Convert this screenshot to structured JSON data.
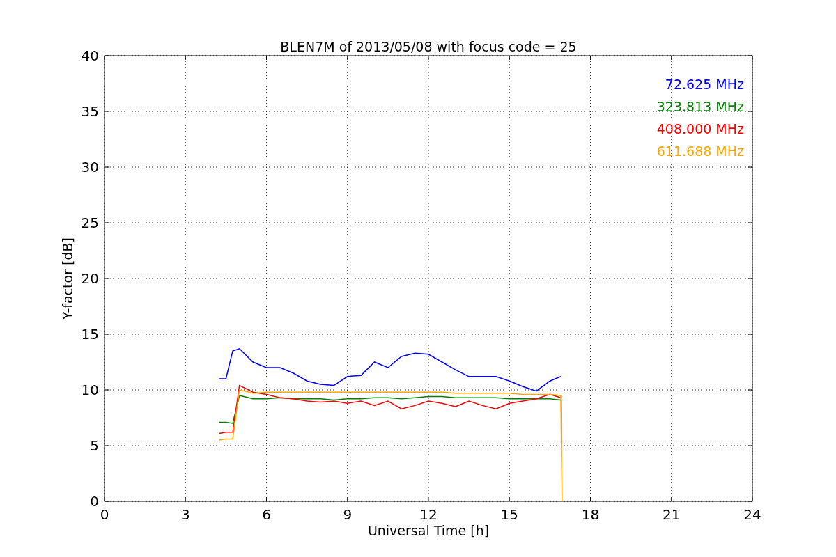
{
  "figure": {
    "chart_data": {
      "type": "line",
      "title": "BLEN7M of 2013/05/08 with focus code = 25",
      "xlabel": "Universal Time [h]",
      "ylabel": "Y-factor [dB]",
      "x": [
        4.25,
        4.5,
        4.75,
        5,
        5.5,
        6,
        6.5,
        7,
        7.5,
        8,
        8.5,
        9,
        9.5,
        10,
        10.5,
        11,
        11.5,
        12,
        12.5,
        13,
        13.5,
        14,
        14.5,
        15,
        15.5,
        16,
        16.5,
        16.9,
        16.95
      ],
      "series": [
        {
          "name": "72.625 MHz",
          "color": "#0000ff",
          "values": [
            11,
            11,
            13.5,
            13.7,
            12.5,
            12,
            12,
            11.5,
            10.8,
            10.5,
            10.4,
            11.2,
            11.3,
            12.5,
            12,
            13,
            13.3,
            13.2,
            12.5,
            11.8,
            11.2,
            11.2,
            11.2,
            10.8,
            10.3,
            9.9,
            10.8,
            11.2,
            null
          ]
        },
        {
          "name": "323.813 MHz",
          "color": "#008000",
          "values": [
            7.1,
            7.1,
            7,
            9.5,
            9.2,
            9.2,
            9.3,
            9.2,
            9.2,
            9.2,
            9.1,
            9.2,
            9.2,
            9.3,
            9.3,
            9.2,
            9.3,
            9.4,
            9.4,
            9.3,
            9.3,
            9.3,
            9.3,
            9.2,
            9.2,
            9.2,
            9.2,
            9.1,
            null
          ]
        },
        {
          "name": "408.000 MHz",
          "color": "#ff0000",
          "values": [
            6.1,
            6.2,
            6.2,
            10.4,
            9.8,
            9.6,
            9.3,
            9.2,
            9,
            8.9,
            9,
            8.8,
            9,
            8.6,
            9,
            8.3,
            8.6,
            9,
            8.8,
            8.5,
            9,
            8.6,
            8.3,
            8.8,
            9,
            9.2,
            9.6,
            9.3,
            null
          ]
        },
        {
          "name": "611.688 MHz",
          "color": "#ffa500",
          "values": [
            5.5,
            5.6,
            5.6,
            10,
            9.7,
            9.8,
            9.8,
            9.8,
            9.8,
            9.8,
            9.8,
            9.8,
            9.8,
            9.8,
            9.8,
            9.8,
            9.8,
            9.8,
            9.8,
            9.7,
            9.7,
            9.7,
            9.7,
            9.7,
            9.6,
            9.6,
            9.6,
            9.5,
            0
          ]
        }
      ],
      "grid": true,
      "xlim": [
        0,
        24
      ],
      "ylim": [
        0,
        40
      ],
      "xticks": [
        0,
        3,
        6,
        9,
        12,
        15,
        18,
        21,
        24
      ],
      "yticks": [
        0,
        5,
        10,
        15,
        20,
        25,
        30,
        35,
        40
      ]
    }
  }
}
